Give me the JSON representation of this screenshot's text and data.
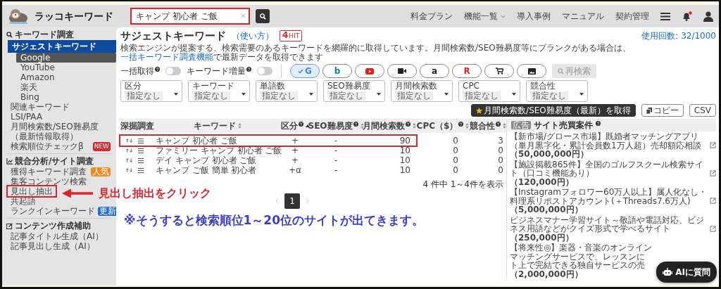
{
  "header": {
    "logo": "ラッコキーワード",
    "search": {
      "value": "キャンプ 初心者 ご飯",
      "highlighted": true
    },
    "nav": [
      {
        "label": "料金プラン",
        "dropdown": false
      },
      {
        "label": "機能一覧",
        "dropdown": true
      },
      {
        "label": "導入事例",
        "dropdown": false
      },
      {
        "label": "マニュアル",
        "dropdown": false
      },
      {
        "label": "契約管理",
        "dropdown": false
      }
    ],
    "notification": true
  },
  "sidebar": {
    "sections": [
      {
        "kind": "search",
        "title": "キーワード調査",
        "items": [
          {
            "label": "サジェストキーワード",
            "selected": true,
            "highlighted": false,
            "children": [
              {
                "label": "Google",
                "selected": true
              },
              {
                "label": "YouTube",
                "selected": false
              },
              {
                "label": "Amazon",
                "selected": false
              },
              {
                "label": "楽天",
                "selected": false
              },
              {
                "label": "Bing",
                "selected": false
              }
            ]
          },
          {
            "label": "関連キーワード",
            "selected": false,
            "highlighted": false
          },
          {
            "label": "LSI/PAA",
            "selected": false,
            "highlighted": false
          },
          {
            "label": "月間検索数/SEO難易度",
            "note": "（最新情報取得）",
            "selected": false,
            "highlighted": false
          },
          {
            "label": "検索順位チェックβ",
            "selected": false,
            "highlighted": false,
            "badge": {
              "kind": "new",
              "text": "NEW"
            }
          }
        ]
      },
      {
        "kind": "chart",
        "title": "競合分析/サイト調査",
        "items": [
          {
            "label": "獲得キーワード調査",
            "selected": false,
            "highlighted": false,
            "badge": {
              "kind": "popular",
              "text": "人気"
            }
          },
          {
            "label": "集客コンテンツ検索",
            "selected": false,
            "highlighted": false
          },
          {
            "label": "見出し抽出",
            "selected": false,
            "highlighted": true
          },
          {
            "label": "共起語",
            "selected": false,
            "highlighted": false
          },
          {
            "label": "ランクインキーワード",
            "selected": false,
            "highlighted": false,
            "badge": {
              "kind": "update",
              "text": "更新"
            }
          }
        ]
      },
      {
        "kind": "edit",
        "title": "コンテンツ作成補助",
        "items": [
          {
            "label": "記事タイトル生成（AI）",
            "selected": false,
            "highlighted": false
          },
          {
            "label": "記事見出し生成（AI）",
            "selected": false,
            "highlighted": false
          }
        ]
      }
    ]
  },
  "page": {
    "title": "サジェストキーワード",
    "help_link": "（使い方）",
    "hit_count": "4",
    "hit_unit": "HIT",
    "usage": "使用回数: 32/1000",
    "description": {
      "before": "検索エンジンが提案する、検索需要のあるキーワードを網羅的に取得しています。月間検索数/SEO難易度等にブランクがある場合は、",
      "link": "一括キーワード調査機能",
      "after": "で最新データを取得できます"
    }
  },
  "toggles": [
    {
      "label": "一括取得",
      "on": false
    },
    {
      "label": "キーワード増量",
      "on": false
    }
  ],
  "engines": [
    {
      "kind": "google",
      "label": "G",
      "selected": true
    },
    {
      "kind": "bing",
      "label": "b",
      "selected": false
    },
    {
      "kind": "youtube",
      "selected": false
    },
    {
      "kind": "video",
      "selected": false
    },
    {
      "kind": "amazon",
      "label": "a",
      "selected": false
    },
    {
      "kind": "rakuten",
      "label": "R",
      "selected": false
    },
    {
      "kind": "shopping",
      "selected": false
    },
    {
      "kind": "image",
      "selected": false
    }
  ],
  "research_button": {
    "label": "再検索",
    "disabled": true
  },
  "filters": [
    {
      "label": "区分",
      "value": "指定なし"
    },
    {
      "label": "キーワード",
      "value": "指定なし"
    },
    {
      "label": "単語数",
      "value": "指定なし"
    },
    {
      "label": "SEO難易度",
      "value": "指定なし"
    },
    {
      "label": "月間検索数",
      "value": "指定なし"
    },
    {
      "label": "CPC",
      "value": "指定なし"
    },
    {
      "label": "競合性",
      "value": "指定なし"
    }
  ],
  "actions": [
    {
      "kind": "fetch",
      "label": "月間検索数/SEO難易度（最新）を取得"
    },
    {
      "kind": "copy",
      "label": "コピー"
    },
    {
      "kind": "csv",
      "label": "CSV"
    }
  ],
  "table": {
    "columns": [
      {
        "label": "深掘調査"
      },
      {
        "label": "キーワード",
        "help": false,
        "sortable": true,
        "sorted": false
      },
      {
        "label": "区分",
        "help": true,
        "sortable": true,
        "sorted": true
      },
      {
        "label": "SEO難易度",
        "help": true,
        "sortable": true,
        "sorted": false
      },
      {
        "label": "月間検索数",
        "help": true,
        "sortable": true,
        "sorted": false
      },
      {
        "label": "CPC（$）",
        "help": true,
        "sortable": true,
        "sorted": false
      },
      {
        "label": "競合性",
        "help": true,
        "sortable": true,
        "sorted": false
      }
    ],
    "rows": [
      {
        "keyword": "キャンプ 初心者 ご飯",
        "type": "+",
        "seo": "-",
        "volume": "90",
        "cpc": "0",
        "competition": "3",
        "highlighted": true
      },
      {
        "keyword": "ファミリー キャンプ 初心者 ご飯",
        "type": "+",
        "seo": "-",
        "volume": "10",
        "cpc": "0",
        "competition": "0",
        "highlighted": false
      },
      {
        "keyword": "デイ キャンプ 初心者 ご飯",
        "type": "+",
        "seo": "-",
        "volume": "10",
        "cpc": "0",
        "competition": "0",
        "highlighted": false
      },
      {
        "keyword": "キャンプ ご飯 簡単 初心者",
        "type": "+α",
        "seo": "-",
        "volume": "10",
        "cpc": "0",
        "competition": "0",
        "highlighted": false
      }
    ],
    "summary": "4 件中 1～4件を表示",
    "pages": [
      {
        "label": "1",
        "selected": true
      }
    ]
  },
  "ads": {
    "badge": "広告",
    "title": "サイト売買案件",
    "items": [
      {
        "kind": "full",
        "title": "【新市場/グロース市場】既婚者マッチングアプリ（単月黒字化・累計会員数1万人超）売却額応相談",
        "price": "（50,000,000円）"
      },
      {
        "kind": "full",
        "title": "【施設掲載865件】全国のゴルフスクール検索サイト（口コミ機能あり）",
        "price": "（120,000円）"
      },
      {
        "kind": "full",
        "title": "【Instagramフォロワー60万人以上】属人化なし・料理系リポストアカウント(＋Threads7.6万人)",
        "price": "（5,000,000円）"
      },
      {
        "kind": "full",
        "title": "ビジネスマナー学習サイト～敬語や電話対応、ビジネス用語などがクイズ形式で学べるサイト",
        "price": "（250,000円）"
      },
      {
        "kind": "partial",
        "lines": [
          "【将来性◎】楽器・音楽のオンライン",
          "マッチングサービスで、レッスンに",
          "ト上で完結できる独自サービスの売"
        ],
        "price": "（2,000,000円）"
      }
    ]
  },
  "ai_button": {
    "label": "AIに質問"
  },
  "annotations": [
    {
      "kind": "callout",
      "text": "見出し抽出をクリック"
    },
    {
      "kind": "note",
      "text": "※そうすると検索順位1～20位のサイトが出てきます。"
    }
  ]
}
